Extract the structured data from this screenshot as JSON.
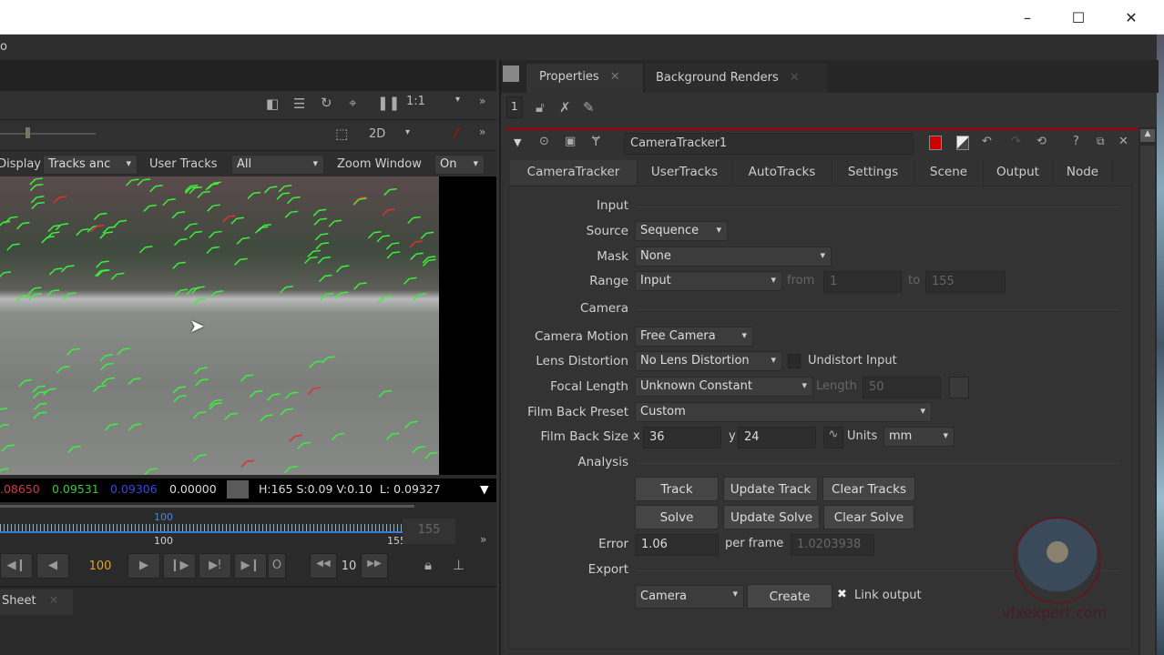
{
  "window": {
    "minimize": "–",
    "maximize": "☐",
    "close": "✕"
  },
  "menu": {
    "partial": "o"
  },
  "viewer": {
    "zoom_ratio": "1:1",
    "view_mode": "2D",
    "display_label": "Display",
    "display_value": "Tracks anc",
    "user_tracks_label": "User Tracks",
    "user_tracks_value": "All",
    "zoom_window_label": "Zoom Window",
    "zoom_window_value": "On",
    "scale_ticks": [
      "1",
      "4"
    ],
    "pixel": {
      "r": ".08650",
      "g": "0.09531",
      "b": "0.09306",
      "a": "0.00000",
      "hsvl": "H:165 S:0.09 V:0.10  L: 0.09327",
      "swatch": "#5a5a5a"
    }
  },
  "timeline": {
    "current_marker": "100",
    "tick_mid": "100",
    "tick_end": "155",
    "end_field": "155",
    "frame": "100",
    "step": "10",
    "o_label": "O",
    "current_fraction": 0.64
  },
  "bottom_tab": {
    "label": "Sheet"
  },
  "properties": {
    "tabs": [
      {
        "label": "Properties"
      },
      {
        "label": "Background Renders"
      }
    ],
    "panel_count": "1",
    "node_name": "CameraTracker1",
    "node_tabs": [
      "CameraTracker",
      "UserTracks",
      "AutoTracks",
      "Settings",
      "Scene",
      "Output",
      "Node"
    ],
    "sections": {
      "input": "Input",
      "camera": "Camera",
      "analysis": "Analysis",
      "export": "Export"
    },
    "source": {
      "label": "Source",
      "value": "Sequence"
    },
    "mask": {
      "label": "Mask",
      "value": "None"
    },
    "range": {
      "label": "Range",
      "value": "Input",
      "from_label": "from",
      "from": "1",
      "to_label": "to",
      "to": "155"
    },
    "camera_motion": {
      "label": "Camera Motion",
      "value": "Free Camera"
    },
    "lens_distortion": {
      "label": "Lens Distortion",
      "value": "No Lens Distortion",
      "undistort_label": "Undistort Input"
    },
    "focal_length": {
      "label": "Focal Length",
      "value": "Unknown Constant",
      "length_label": "Length",
      "length": "50"
    },
    "film_back_preset": {
      "label": "Film Back Preset",
      "value": "Custom"
    },
    "film_back_size": {
      "label": "Film Back Size",
      "x_label": "x",
      "x": "36",
      "y_label": "y",
      "y": "24",
      "units_label": "Units",
      "units": "mm"
    },
    "buttons": {
      "track": "Track",
      "update_track": "Update Track",
      "clear_tracks": "Clear Tracks",
      "solve": "Solve",
      "update_solve": "Update Solve",
      "clear_solve": "Clear Solve",
      "create": "Create"
    },
    "error": {
      "label": "Error",
      "value": "1.06",
      "per_frame_label": "per frame",
      "per_frame": "1.0203938"
    },
    "export": {
      "value": "Camera",
      "link_label": "Link output",
      "link_checked": "✖"
    }
  },
  "watermark": {
    "text": "vfxexpert.com"
  }
}
